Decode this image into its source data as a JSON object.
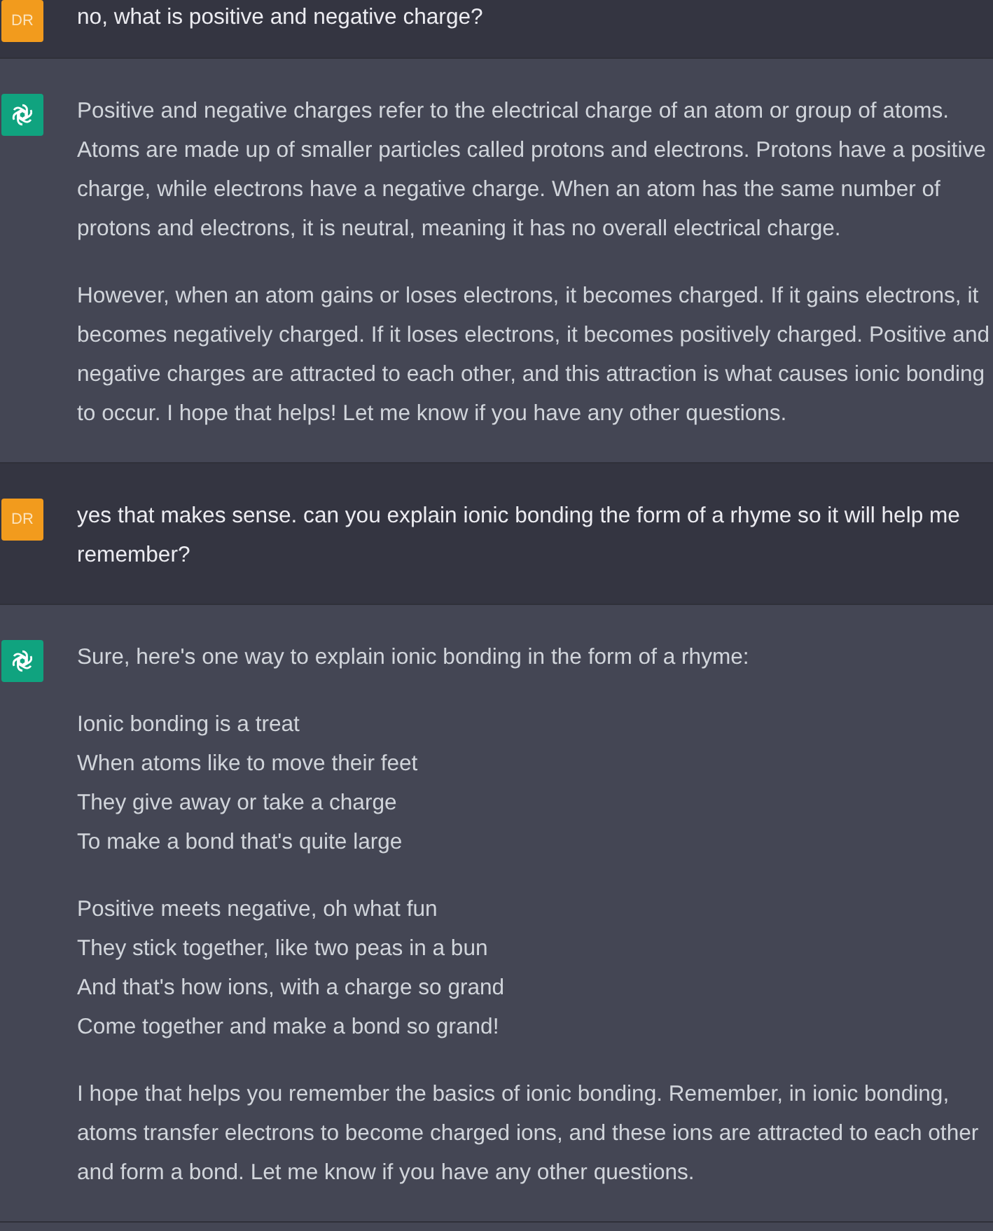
{
  "messages": [
    {
      "kind": "user",
      "avatar": "DR",
      "blocks": [
        {
          "kind": "paragraph",
          "text": "no, what is positive and negative charge?"
        }
      ]
    },
    {
      "kind": "assistant",
      "blocks": [
        {
          "kind": "paragraph",
          "text": "Positive and negative charges refer to the electrical charge of an atom or group of atoms. Atoms are made up of smaller particles called protons and electrons. Protons have a positive charge, while electrons have a negative charge. When an atom has the same number of protons and electrons, it is neutral, meaning it has no overall electrical charge."
        },
        {
          "kind": "paragraph",
          "text": "However, when an atom gains or loses electrons, it becomes charged. If it gains electrons, it becomes negatively charged. If it loses electrons, it becomes positively charged. Positive and negative charges are attracted to each other, and this attraction is what causes ionic bonding to occur. I hope that helps! Let me know if you have any other questions."
        }
      ]
    },
    {
      "kind": "user",
      "avatar": "DR",
      "blocks": [
        {
          "kind": "paragraph",
          "text": "yes that makes sense. can you explain ionic bonding the form of a rhyme so it will help me remember?"
        }
      ]
    },
    {
      "kind": "assistant",
      "blocks": [
        {
          "kind": "paragraph",
          "text": "Sure, here's one way to explain ionic bonding in the form of a rhyme:"
        },
        {
          "kind": "verse",
          "lines": [
            "Ionic bonding is a treat",
            "When atoms like to move their feet",
            "They give away or take a charge",
            "To make a bond that's quite large"
          ]
        },
        {
          "kind": "verse",
          "lines": [
            "Positive meets negative, oh what fun",
            "They stick together, like two peas in a bun",
            "And that's how ions, with a charge so grand",
            "Come together and make a bond so grand!"
          ]
        },
        {
          "kind": "paragraph",
          "text": "I hope that helps you remember the basics of ionic bonding. Remember, in ionic bonding, atoms transfer electrons to become charged ions, and these ions are attracted to each other and form a bond. Let me know if you have any other questions."
        }
      ]
    }
  ]
}
